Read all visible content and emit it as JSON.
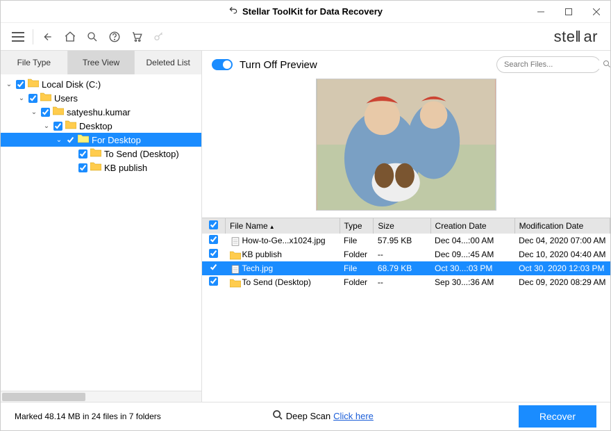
{
  "window": {
    "title": "Stellar ToolKit for Data Recovery"
  },
  "brand": {
    "text": "stellar"
  },
  "tabs": {
    "file_type": "File Type",
    "tree_view": "Tree View",
    "deleted_list": "Deleted List"
  },
  "tree": {
    "nodes": [
      {
        "indent": 0,
        "toggle": "v",
        "label": "Local Disk (C:)",
        "selected": false
      },
      {
        "indent": 1,
        "toggle": "v",
        "label": "Users",
        "selected": false
      },
      {
        "indent": 2,
        "toggle": "v",
        "label": "satyeshu.kumar",
        "selected": false
      },
      {
        "indent": 3,
        "toggle": "v",
        "label": "Desktop",
        "selected": false
      },
      {
        "indent": 4,
        "toggle": "v",
        "label": "For Desktop",
        "selected": true
      },
      {
        "indent": 5,
        "toggle": "",
        "label": "To Send (Desktop)",
        "selected": false
      },
      {
        "indent": 5,
        "toggle": "",
        "label": "KB publish",
        "selected": false
      }
    ]
  },
  "preview": {
    "toggle_label": "Turn Off Preview",
    "search_placeholder": "Search Files..."
  },
  "columns": {
    "name": "File Name",
    "type": "Type",
    "size": "Size",
    "cdate": "Creation Date",
    "mdate": "Modification Date"
  },
  "files": [
    {
      "icon": "file",
      "name": "How-to-Ge...x1024.jpg",
      "type": "File",
      "size": "57.95 KB",
      "cdate": "Dec 04...:00 AM",
      "mdate": "Dec 04, 2020 07:00 AM",
      "selected": false
    },
    {
      "icon": "folder",
      "name": "KB publish",
      "type": "Folder",
      "size": "--",
      "cdate": "Dec 09...:45 AM",
      "mdate": "Dec 10, 2020 04:40 AM",
      "selected": false
    },
    {
      "icon": "file",
      "name": "Tech.jpg",
      "type": "File",
      "size": "68.79 KB",
      "cdate": "Oct 30...:03 PM",
      "mdate": "Oct 30, 2020 12:03 PM",
      "selected": true
    },
    {
      "icon": "folder",
      "name": "To Send (Desktop)",
      "type": "Folder",
      "size": "--",
      "cdate": "Sep 30...:36 AM",
      "mdate": "Dec 09, 2020 08:29 AM",
      "selected": false
    }
  ],
  "footer": {
    "status": "Marked 48.14 MB in 24 files in 7 folders",
    "deep_label": "Deep Scan",
    "deep_link": "Click here",
    "recover": "Recover"
  }
}
